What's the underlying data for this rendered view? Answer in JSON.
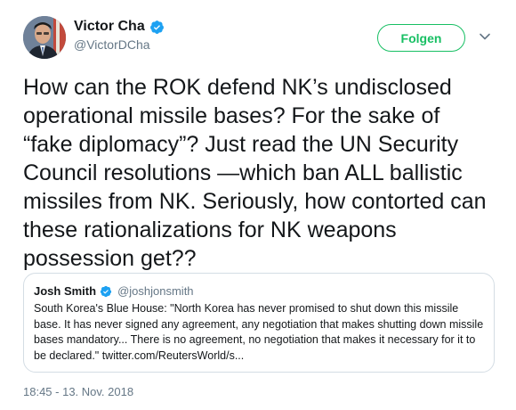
{
  "author": {
    "display_name": "Victor Cha",
    "handle": "@VictorDCha",
    "verified": true,
    "avatar_icon": "profile-photo"
  },
  "follow_button": {
    "label": "Folgen"
  },
  "menu": {
    "icon": "chevron-down-icon"
  },
  "tweet": {
    "text": "How can the ROK defend NK’s undisclosed operational missile bases? For the sake of “fake diplomacy”? Just read the UN Security Council resolutions —which ban ALL ballistic missiles from NK. Seriously, how contorted can these rationalizations for NK weapons possession get??"
  },
  "quoted_tweet": {
    "display_name": "Josh Smith",
    "handle": "@joshjonsmith",
    "verified": true,
    "text": "South Korea's Blue House: \"North Korea has never promised to shut down this missile base. It has never signed any agreement, any negotiation that makes shutting down missile bases mandatory... There is no agreement, no negotiation that makes it necessary for it to be declared.\" twitter.com/ReutersWorld/s..."
  },
  "timestamp": "18:45 - 13. Nov. 2018",
  "colors": {
    "verified_blue": "#1da1f2",
    "follow_green": "#17bf63",
    "secondary_text": "#657786",
    "border": "#d4dde4"
  }
}
